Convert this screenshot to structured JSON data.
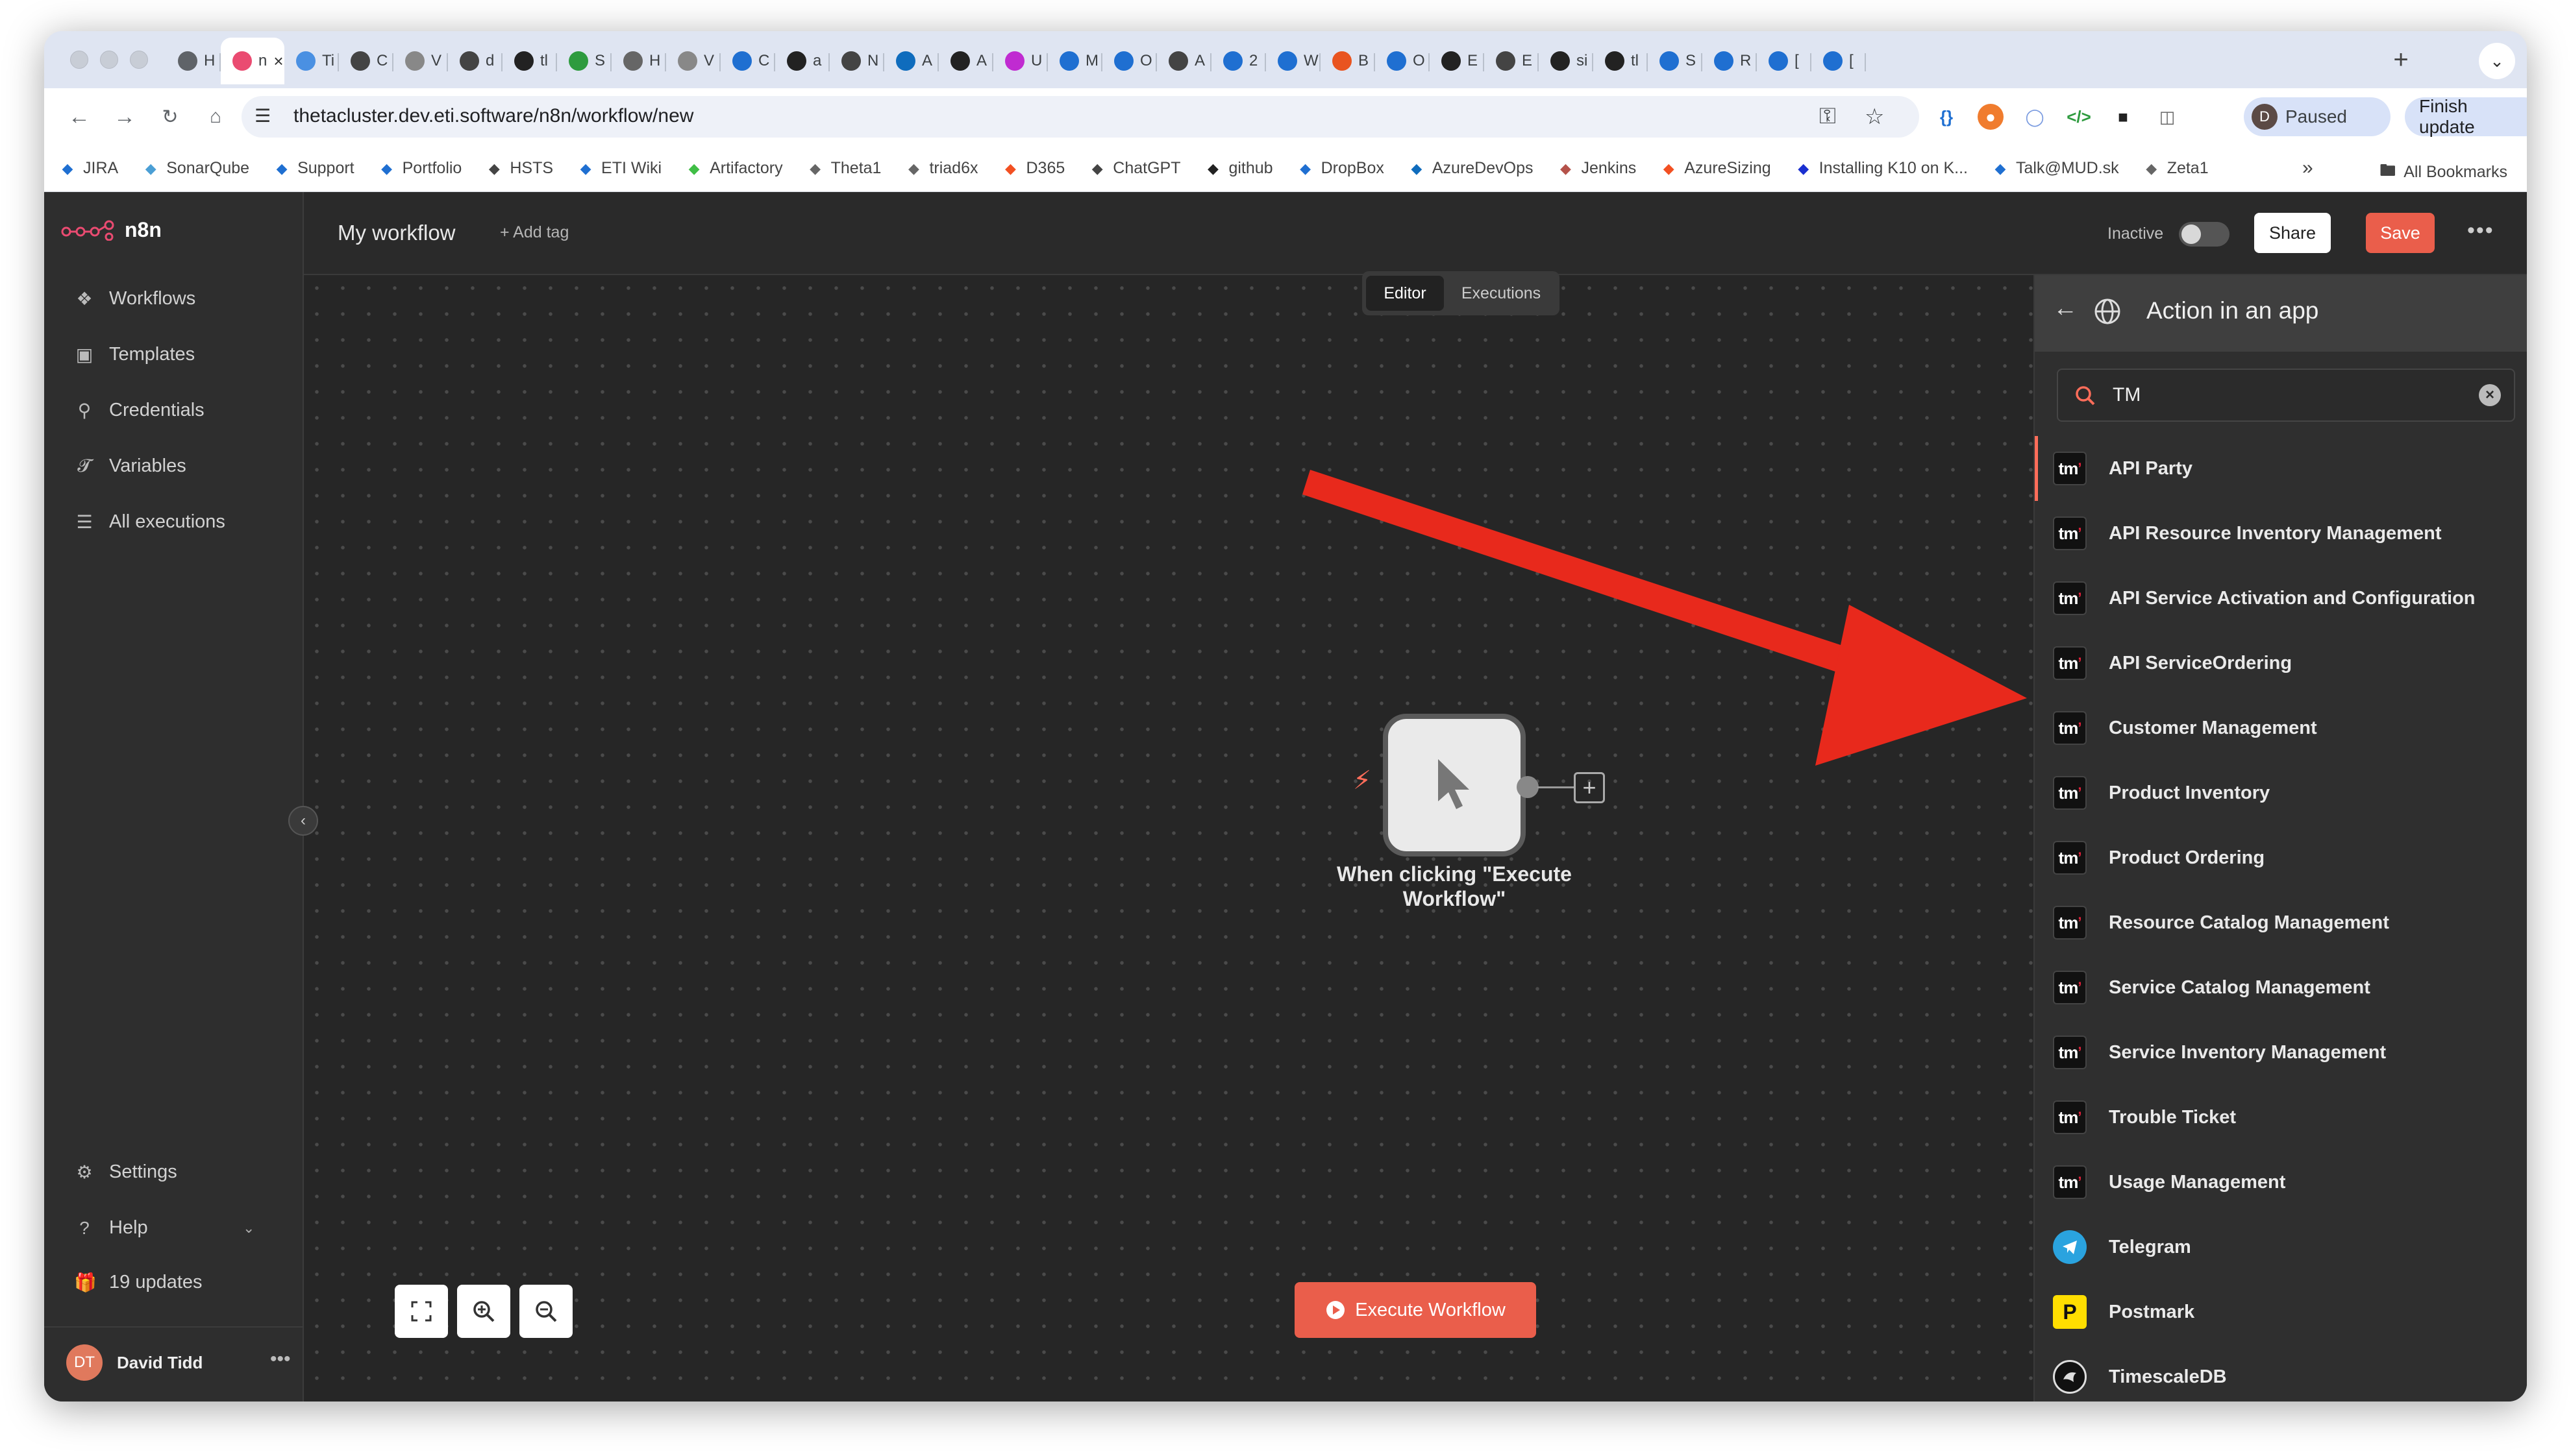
{
  "browser": {
    "tabs": [
      {
        "title": "H",
        "icon": "jira-icon",
        "color": "#5f6368"
      },
      {
        "title": "n",
        "icon": "n8n-icon",
        "color": "#ea4b71",
        "active": true
      },
      {
        "title": "Ti",
        "icon": "globe-icon",
        "color": "#4a90e2"
      },
      {
        "title": "C",
        "icon": "chatgpt-icon",
        "color": "#444"
      },
      {
        "title": "V",
        "icon": "dots-icon",
        "color": "#888"
      },
      {
        "title": "d",
        "icon": "chatgpt-icon",
        "color": "#444"
      },
      {
        "title": "tl",
        "icon": "github-icon",
        "color": "#222"
      },
      {
        "title": "S",
        "icon": "green-circle-icon",
        "color": "#2e9b3f"
      },
      {
        "title": "H",
        "icon": "helm-icon",
        "color": "#666"
      },
      {
        "title": "V",
        "icon": "dots-icon",
        "color": "#888"
      },
      {
        "title": "C",
        "icon": "confluence-icon",
        "color": "#1f6fd1"
      },
      {
        "title": "a",
        "icon": "github-icon",
        "color": "#222"
      },
      {
        "title": "N",
        "icon": "chatgpt-icon",
        "color": "#444"
      },
      {
        "title": "A",
        "icon": "azure-icon",
        "color": "#0f6cbd"
      },
      {
        "title": "A",
        "icon": "github-icon",
        "color": "#222"
      },
      {
        "title": "U",
        "icon": "s-icon",
        "color": "#c02bd1"
      },
      {
        "title": "M",
        "icon": "cloud-icon",
        "color": "#1f6fd1"
      },
      {
        "title": "O",
        "icon": "cloud-icon",
        "color": "#1f6fd1"
      },
      {
        "title": "A",
        "icon": "arrow-icon",
        "color": "#444"
      },
      {
        "title": "2",
        "icon": "confluence-icon",
        "color": "#1f6fd1"
      },
      {
        "title": "W",
        "icon": "confluence-icon",
        "color": "#1f6fd1"
      },
      {
        "title": "B",
        "icon": "orange-icon",
        "color": "#e95420"
      },
      {
        "title": "O",
        "icon": "cloud-icon",
        "color": "#1f6fd1"
      },
      {
        "title": "E",
        "icon": "heart-icon",
        "color": "#222"
      },
      {
        "title": "E",
        "icon": "chatgpt-icon",
        "color": "#444"
      },
      {
        "title": "si",
        "icon": "github-icon",
        "color": "#222"
      },
      {
        "title": "tl",
        "icon": "github-icon",
        "color": "#222"
      },
      {
        "title": "S",
        "icon": "blue-icon",
        "color": "#1f6fd1"
      },
      {
        "title": "R",
        "icon": "confluence-icon",
        "color": "#1f6fd1"
      },
      {
        "title": "[",
        "icon": "jira-icon",
        "color": "#1f6fd1"
      },
      {
        "title": "[",
        "icon": "jira-icon",
        "color": "#1f6fd1"
      }
    ],
    "url": "thetacluster.dev.eti.software/n8n/workflow/new",
    "profile_initial": "D",
    "profile_status": "Paused",
    "finish_update": "Finish update",
    "bookmarks": [
      {
        "label": "JIRA",
        "icon": "jira-icon",
        "color": "#1f6fd1"
      },
      {
        "label": "SonarQube",
        "icon": "sonar-icon",
        "color": "#4b9fd5"
      },
      {
        "label": "Support",
        "icon": "jira-icon",
        "color": "#1f6fd1"
      },
      {
        "label": "Portfolio",
        "icon": "jira-icon",
        "color": "#1f6fd1"
      },
      {
        "label": "HSTS",
        "icon": "chatgpt-icon",
        "color": "#444"
      },
      {
        "label": "ETI Wiki",
        "icon": "confluence-icon",
        "color": "#1f6fd1"
      },
      {
        "label": "Artifactory",
        "icon": "frog-icon",
        "color": "#40be46"
      },
      {
        "label": "Theta1",
        "icon": "globe-icon",
        "color": "#666"
      },
      {
        "label": "triad6x",
        "icon": "globe-icon",
        "color": "#666"
      },
      {
        "label": "D365",
        "icon": "microsoft-icon",
        "color": "#f25022"
      },
      {
        "label": "ChatGPT",
        "icon": "chatgpt-icon",
        "color": "#444"
      },
      {
        "label": "github",
        "icon": "github-icon",
        "color": "#222"
      },
      {
        "label": "DropBox",
        "icon": "dropbox-icon",
        "color": "#1f6fd1"
      },
      {
        "label": "AzureDevOps",
        "icon": "azure-icon",
        "color": "#0f6cbd"
      },
      {
        "label": "Jenkins",
        "icon": "jenkins-icon",
        "color": "#b5524a"
      },
      {
        "label": "AzureSizing",
        "icon": "microsoft-icon",
        "color": "#f25022"
      },
      {
        "label": "Installing K10 on K...",
        "icon": "k-icon",
        "color": "#1a2fd0"
      },
      {
        "label": "Talk@MUD.sk",
        "icon": "power-icon",
        "color": "#1f6fd1"
      },
      {
        "label": "Zeta1",
        "icon": "globe-icon",
        "color": "#666"
      }
    ],
    "all_bookmarks": "All Bookmarks"
  },
  "sidebar": {
    "brand": "n8n",
    "items": [
      {
        "label": "Workflows",
        "icon": "workflows-icon"
      },
      {
        "label": "Templates",
        "icon": "templates-icon"
      },
      {
        "label": "Credentials",
        "icon": "key-icon"
      },
      {
        "label": "Variables",
        "icon": "variables-icon"
      },
      {
        "label": "All executions",
        "icon": "list-icon"
      }
    ],
    "bottom_items": [
      {
        "label": "Settings",
        "icon": "gear-icon"
      },
      {
        "label": "Help",
        "icon": "question-icon"
      },
      {
        "label": "19 updates",
        "icon": "gift-icon"
      }
    ],
    "user_initials": "DT",
    "user_name": "David Tidd"
  },
  "header": {
    "workflow_name": "My workflow",
    "add_tag": "+ Add tag",
    "status_label": "Inactive",
    "share": "Share",
    "save": "Save",
    "tabs": [
      "Editor",
      "Executions"
    ]
  },
  "canvas": {
    "node_label": "When clicking \"Execute Workflow\"",
    "execute_button": "Execute Workflow"
  },
  "panel": {
    "title": "Action in an app",
    "search_value": "TM",
    "results": [
      {
        "label": "API Party",
        "icon": "tm-icon",
        "selected": true
      },
      {
        "label": "API Resource Inventory Management",
        "icon": "tm-icon"
      },
      {
        "label": "API Service Activation and Configuration",
        "icon": "tm-icon"
      },
      {
        "label": "API ServiceOrdering",
        "icon": "tm-icon"
      },
      {
        "label": "Customer Management",
        "icon": "tm-icon"
      },
      {
        "label": "Product Inventory",
        "icon": "tm-icon"
      },
      {
        "label": "Product Ordering",
        "icon": "tm-icon"
      },
      {
        "label": "Resource Catalog Management",
        "icon": "tm-icon"
      },
      {
        "label": "Service Catalog Management",
        "icon": "tm-icon"
      },
      {
        "label": "Service Inventory Management",
        "icon": "tm-icon"
      },
      {
        "label": "Trouble Ticket",
        "icon": "tm-icon"
      },
      {
        "label": "Usage Management",
        "icon": "tm-icon"
      },
      {
        "label": "Telegram",
        "icon": "telegram-icon"
      },
      {
        "label": "Postmark",
        "icon": "postmark-icon"
      },
      {
        "label": "TimescaleDB",
        "icon": "timescaledb-icon"
      }
    ]
  },
  "colors": {
    "accent": "#ea5e4b",
    "annotation_arrow": "#e8291c",
    "sidebar_bg": "#2e2e2e",
    "canvas_bg": "#262626"
  }
}
